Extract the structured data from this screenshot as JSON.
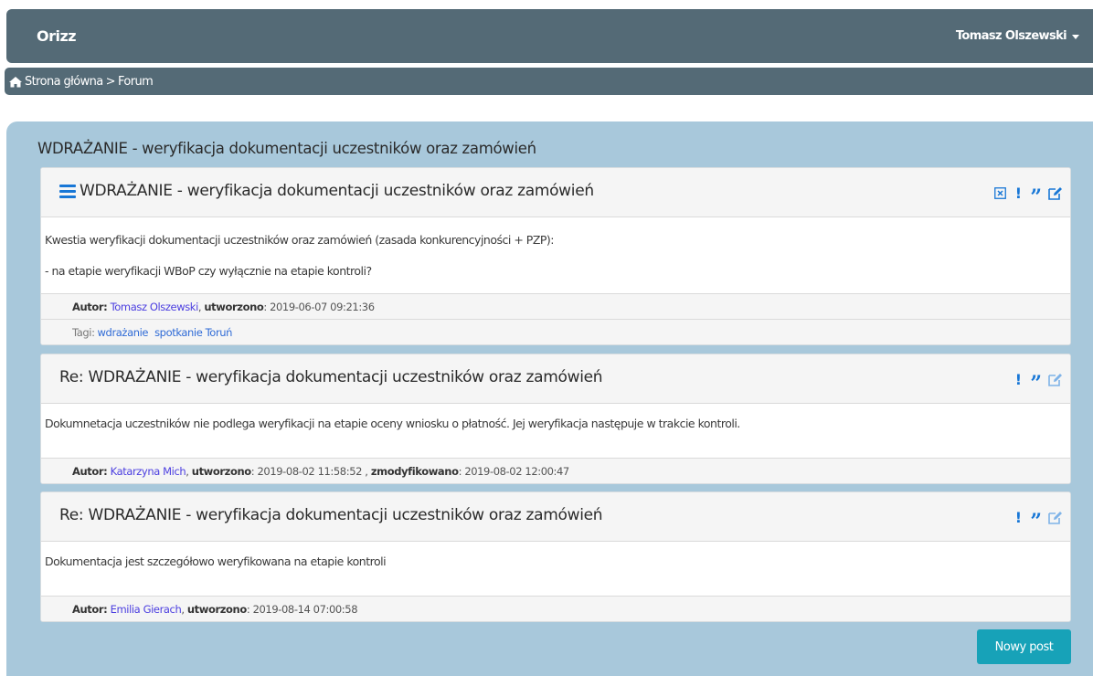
{
  "navbar": {
    "brand": "Orizz",
    "user": "Tomasz Olszewski"
  },
  "breadcrumb": {
    "home": "Strona główna",
    "separator": ">",
    "current": "Forum"
  },
  "page_title": "WDRAŻANIE - weryfikacja dokumentacji uczestników oraz zamówień",
  "labels": {
    "author": "Autor:",
    "created": "utworzono",
    "modified": "zmodyfikowano",
    "tags": "Tagi:"
  },
  "posts": [
    {
      "title": "WDRAŻANIE - weryfikacja dokumentacji uczestników oraz zamówień",
      "body": [
        "Kwestia weryfikacji dokumentacji uczestników oraz zamówień (zasada konkurencyjności + PZP):",
        "- na etapie weryfikacji WBoP czy wyłącznie na etapie kontroli?"
      ],
      "author": "Tomasz Olszewski",
      "created": "2019-06-07 09:21:36",
      "tags": [
        "wdrażanie",
        "spotkanie Toruń"
      ]
    },
    {
      "title": "Re: WDRAŻANIE - weryfikacja dokumentacji uczestników oraz zamówień",
      "body": [
        "Dokumnetacja uczestników nie podlega weryfikacji na etapie oceny wniosku o płatność. Jej weryfikacja następuje w trakcie kontroli."
      ],
      "author": "Katarzyna Mich",
      "created": "2019-08-02 11:58:52",
      "modified": "2019-08-02 12:00:47"
    },
    {
      "title": "Re: WDRAŻANIE - weryfikacja dokumentacji uczestników oraz zamówień",
      "body": [
        "Dokumentacja jest szczegółowo weryfikowana na etapie kontroli"
      ],
      "author": "Emilia Gierach",
      "created": "2019-08-14 07:00:58"
    }
  ],
  "icons": {
    "exclaim": "!",
    "quote": "”"
  },
  "new_post_label": "Nowy post",
  "colors": {
    "navbar": "#546a76",
    "panel": "#a8c8db",
    "accent": "#1877d6",
    "button": "#17a2b8"
  }
}
